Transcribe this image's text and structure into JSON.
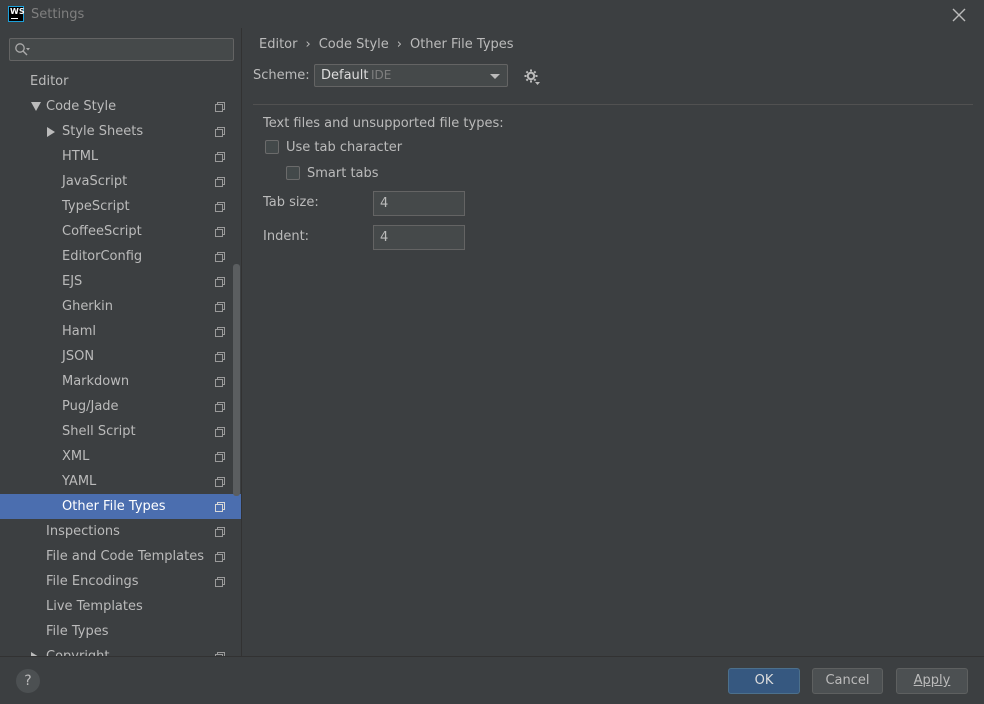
{
  "window": {
    "title": "Settings",
    "logo_text": "WS"
  },
  "sidebar": {
    "search_placeholder": "",
    "items": [
      {
        "label": "Editor",
        "level": 0,
        "arrow": "none",
        "copy": false,
        "selected": false
      },
      {
        "label": "Code Style",
        "level": 1,
        "arrow": "down",
        "copy": true,
        "selected": false
      },
      {
        "label": "Style Sheets",
        "level": 2,
        "arrow": "right",
        "copy": true,
        "selected": false
      },
      {
        "label": "HTML",
        "level": 2,
        "arrow": "none",
        "copy": true,
        "selected": false
      },
      {
        "label": "JavaScript",
        "level": 2,
        "arrow": "none",
        "copy": true,
        "selected": false
      },
      {
        "label": "TypeScript",
        "level": 2,
        "arrow": "none",
        "copy": true,
        "selected": false
      },
      {
        "label": "CoffeeScript",
        "level": 2,
        "arrow": "none",
        "copy": true,
        "selected": false
      },
      {
        "label": "EditorConfig",
        "level": 2,
        "arrow": "none",
        "copy": true,
        "selected": false
      },
      {
        "label": "EJS",
        "level": 2,
        "arrow": "none",
        "copy": true,
        "selected": false
      },
      {
        "label": "Gherkin",
        "level": 2,
        "arrow": "none",
        "copy": true,
        "selected": false
      },
      {
        "label": "Haml",
        "level": 2,
        "arrow": "none",
        "copy": true,
        "selected": false
      },
      {
        "label": "JSON",
        "level": 2,
        "arrow": "none",
        "copy": true,
        "selected": false
      },
      {
        "label": "Markdown",
        "level": 2,
        "arrow": "none",
        "copy": true,
        "selected": false
      },
      {
        "label": "Pug/Jade",
        "level": 2,
        "arrow": "none",
        "copy": true,
        "selected": false
      },
      {
        "label": "Shell Script",
        "level": 2,
        "arrow": "none",
        "copy": true,
        "selected": false
      },
      {
        "label": "XML",
        "level": 2,
        "arrow": "none",
        "copy": true,
        "selected": false
      },
      {
        "label": "YAML",
        "level": 2,
        "arrow": "none",
        "copy": true,
        "selected": false
      },
      {
        "label": "Other File Types",
        "level": 2,
        "arrow": "none",
        "copy": true,
        "selected": true
      },
      {
        "label": "Inspections",
        "level": 1,
        "arrow": "none",
        "copy": true,
        "selected": false
      },
      {
        "label": "File and Code Templates",
        "level": 1,
        "arrow": "none",
        "copy": true,
        "selected": false
      },
      {
        "label": "File Encodings",
        "level": 1,
        "arrow": "none",
        "copy": true,
        "selected": false
      },
      {
        "label": "Live Templates",
        "level": 1,
        "arrow": "none",
        "copy": false,
        "selected": false
      },
      {
        "label": "File Types",
        "level": 1,
        "arrow": "none",
        "copy": false,
        "selected": false
      },
      {
        "label": "Copyright",
        "level": 1,
        "arrow": "right",
        "copy": true,
        "selected": false
      }
    ]
  },
  "main": {
    "breadcrumb": [
      "Editor",
      "Code Style",
      "Other File Types"
    ],
    "breadcrumb_separator": "›",
    "scheme": {
      "label": "Scheme:",
      "value": "Default",
      "tag": "IDE"
    },
    "section_title": "Text files and unsupported file types:",
    "use_tab": {
      "label": "Use tab character",
      "checked": false
    },
    "smart_tabs": {
      "label": "Smart tabs",
      "checked": false
    },
    "tab_size": {
      "label": "Tab size:",
      "value": "4"
    },
    "indent": {
      "label": "Indent:",
      "value": "4"
    }
  },
  "footer": {
    "help_label": "?",
    "ok_label": "OK",
    "cancel_label": "Cancel",
    "apply_label": "Apply"
  },
  "colors": {
    "background": "#3c3f41",
    "selection": "#4b6eaf",
    "primary_button": "#365880",
    "text": "#bbbbbb"
  }
}
